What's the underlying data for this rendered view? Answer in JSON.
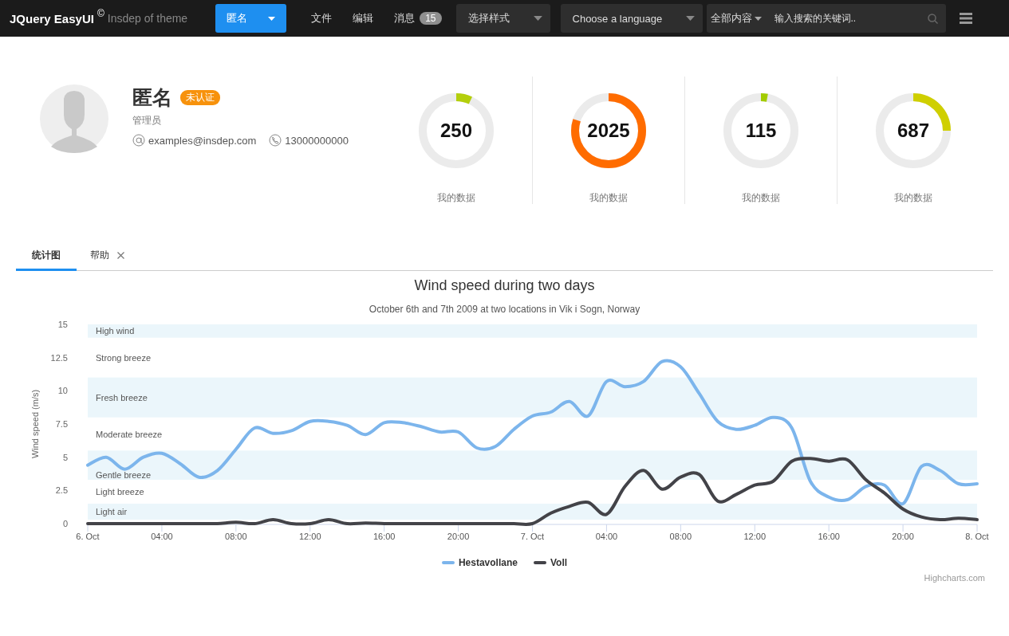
{
  "header": {
    "logo": "JQuery EasyUI",
    "logo_mark": "©",
    "subtitle": "Insdep of theme",
    "user_button": "匿名",
    "menu": [
      {
        "label": "文件"
      },
      {
        "label": "编辑"
      },
      {
        "label": "消息",
        "badge": "15"
      }
    ],
    "style_select": "选择样式",
    "language_select": "Choose a language",
    "search": {
      "scope": "全部内容",
      "placeholder": "输入搜索的关键词.."
    }
  },
  "profile": {
    "name": "匿名",
    "badge": "未认证",
    "role": "管理员",
    "email": "examples@insdep.com",
    "phone": "13000000000"
  },
  "stats": [
    {
      "value": "250",
      "label": "我的数据",
      "level": 0.07,
      "color": "#b4cf0c"
    },
    {
      "value": "2025",
      "label": "我的数据",
      "level": 0.8,
      "color": "#ff6c00"
    },
    {
      "value": "115",
      "label": "我的数据",
      "level": 0.03,
      "color": "#a3cc00"
    },
    {
      "value": "687",
      "label": "我的数据",
      "level": 0.25,
      "color": "#cfcf00"
    }
  ],
  "tabs": [
    {
      "label": "统计图",
      "selected": true,
      "closable": false
    },
    {
      "label": "帮助",
      "selected": false,
      "closable": true
    }
  ],
  "chart": {
    "chart_data": {
      "type": "line",
      "title": "Wind speed during two days",
      "subtitle": "October 6th and 7th 2009 at two locations in Vik i Sogn, Norway",
      "ylabel": "Wind speed (m/s)",
      "x": [
        "2009-10-06T00:00",
        "2009-10-06T01:00",
        "2009-10-06T02:00",
        "2009-10-06T03:00",
        "2009-10-06T04:00",
        "2009-10-06T05:00",
        "2009-10-06T06:00",
        "2009-10-06T07:00",
        "2009-10-06T08:00",
        "2009-10-06T09:00",
        "2009-10-06T10:00",
        "2009-10-06T11:00",
        "2009-10-06T12:00",
        "2009-10-06T13:00",
        "2009-10-06T14:00",
        "2009-10-06T15:00",
        "2009-10-06T16:00",
        "2009-10-06T17:00",
        "2009-10-06T18:00",
        "2009-10-06T19:00",
        "2009-10-06T20:00",
        "2009-10-06T21:00",
        "2009-10-06T22:00",
        "2009-10-06T23:00",
        "2009-10-07T00:00",
        "2009-10-07T01:00",
        "2009-10-07T02:00",
        "2009-10-07T03:00",
        "2009-10-07T04:00",
        "2009-10-07T05:00",
        "2009-10-07T06:00",
        "2009-10-07T07:00",
        "2009-10-07T08:00",
        "2009-10-07T09:00",
        "2009-10-07T10:00",
        "2009-10-07T11:00",
        "2009-10-07T12:00",
        "2009-10-07T13:00",
        "2009-10-07T14:00",
        "2009-10-07T15:00",
        "2009-10-07T16:00",
        "2009-10-07T17:00",
        "2009-10-07T18:00",
        "2009-10-07T19:00",
        "2009-10-07T20:00",
        "2009-10-07T21:00",
        "2009-10-07T22:00",
        "2009-10-07T23:00",
        "2009-10-08T00:00"
      ],
      "xlim": [
        "2009-10-06T00:00",
        "2009-10-08T00:00"
      ],
      "ylim": [
        0,
        15
      ],
      "xticks": [
        {
          "value": "2009-10-06T00:00",
          "label": "6. Oct"
        },
        {
          "value": "2009-10-06T04:00",
          "label": "04:00"
        },
        {
          "value": "2009-10-06T08:00",
          "label": "08:00"
        },
        {
          "value": "2009-10-06T12:00",
          "label": "12:00"
        },
        {
          "value": "2009-10-06T16:00",
          "label": "16:00"
        },
        {
          "value": "2009-10-06T20:00",
          "label": "20:00"
        },
        {
          "value": "2009-10-07T00:00",
          "label": "7. Oct"
        },
        {
          "value": "2009-10-07T04:00",
          "label": "04:00"
        },
        {
          "value": "2009-10-07T08:00",
          "label": "08:00"
        },
        {
          "value": "2009-10-07T12:00",
          "label": "12:00"
        },
        {
          "value": "2009-10-07T16:00",
          "label": "16:00"
        },
        {
          "value": "2009-10-07T20:00",
          "label": "20:00"
        },
        {
          "value": "2009-10-08T00:00",
          "label": "8. Oct"
        }
      ],
      "yticks": [
        0,
        2.5,
        5,
        7.5,
        10,
        12.5,
        15
      ],
      "series": [
        {
          "name": "Hestavollane",
          "color": "#7cb5ec",
          "values": [
            4.4,
            5.0,
            4.1,
            5.0,
            5.3,
            4.5,
            3.5,
            4.0,
            5.6,
            7.2,
            6.8,
            7.0,
            7.7,
            7.7,
            7.4,
            6.7,
            7.6,
            7.6,
            7.3,
            6.9,
            6.9,
            5.7,
            5.8,
            7.1,
            8.1,
            8.4,
            9.2,
            8.1,
            10.7,
            10.3,
            10.7,
            12.2,
            11.8,
            9.8,
            7.7,
            7.1,
            7.4,
            8.0,
            7.2,
            3.2,
            2.0,
            1.8,
            2.8,
            2.9,
            1.5,
            4.3,
            4.0,
            3.0,
            3.0
          ]
        },
        {
          "name": "Voll",
          "color": "#434348",
          "values": [
            0,
            0,
            0,
            0,
            0,
            0,
            0,
            0,
            0.1,
            0,
            0.3,
            0,
            0,
            0.3,
            0,
            0.05,
            0,
            0,
            0,
            0,
            0,
            0,
            0,
            0,
            0,
            0.8,
            1.3,
            1.6,
            0.7,
            2.8,
            4.0,
            2.6,
            3.5,
            3.7,
            1.7,
            2.2,
            2.9,
            3.2,
            4.7,
            4.9,
            4.7,
            4.8,
            3.3,
            2.3,
            1.1,
            0.5,
            0.3,
            0.4,
            0.3
          ]
        }
      ],
      "bands": [
        {
          "axis": "y",
          "label": "Light air",
          "from": 0.3,
          "to": 1.5,
          "color": "#ebf6fb"
        },
        {
          "axis": "y",
          "label": "Gentle breeze",
          "from": 3.3,
          "to": 5.5,
          "color": "#ebf6fb"
        },
        {
          "axis": "y",
          "label": "Fresh breeze",
          "from": 8,
          "to": 11,
          "color": "#ebf6fb"
        },
        {
          "axis": "y",
          "label": "High wind",
          "from": 14,
          "to": 15,
          "color": "#ebf6fb"
        }
      ],
      "annotations": [
        "Light breeze",
        "Moderate breeze",
        "Strong breeze"
      ]
    },
    "credits": "Highcharts.com"
  }
}
